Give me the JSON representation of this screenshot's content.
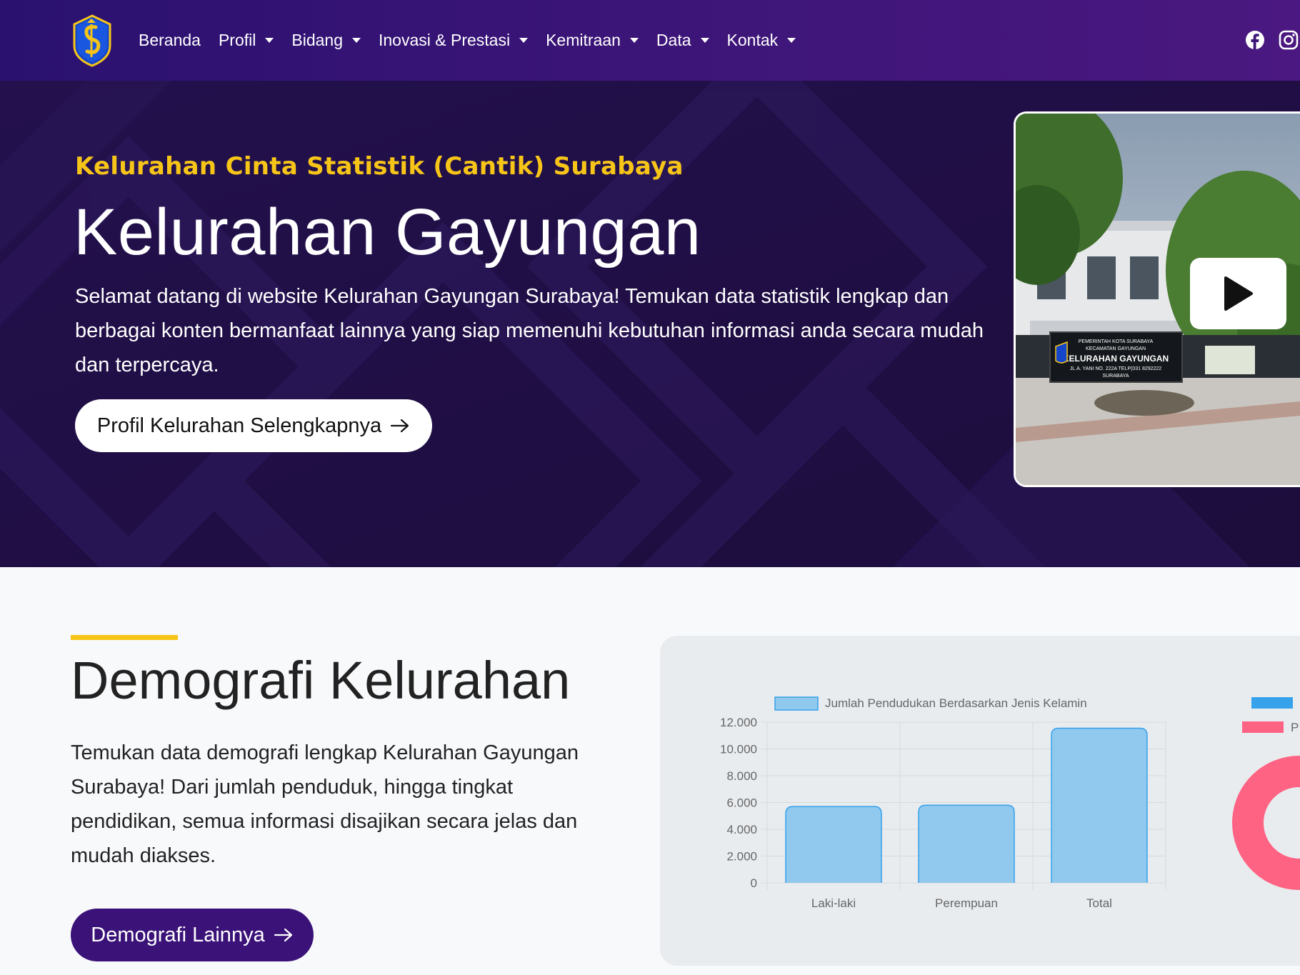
{
  "navbar": {
    "items": [
      {
        "label": "Beranda",
        "dropdown": false
      },
      {
        "label": "Profil",
        "dropdown": true
      },
      {
        "label": "Bidang",
        "dropdown": true
      },
      {
        "label": "Inovasi & Prestasi",
        "dropdown": true
      },
      {
        "label": "Kemitraan",
        "dropdown": true
      },
      {
        "label": "Data",
        "dropdown": true
      },
      {
        "label": "Kontak",
        "dropdown": true
      }
    ],
    "social_icons": [
      "facebook-icon",
      "instagram-icon"
    ]
  },
  "hero": {
    "subtitle": "Kelurahan Cinta Statistik (Cantik) Surabaya",
    "title": "Kelurahan Gayungan",
    "description": "Selamat datang di website Kelurahan Gayungan Surabaya! Temukan data statistik lengkap dan berbagai konten bermanfaat lainnya yang siap memenuhi kebutuhan informasi anda secara mudah dan terpercaya.",
    "button_label": "Profil Kelurahan Selengkapnya",
    "video_sign": {
      "line1": "PEMERINTAH KOTA SURABAYA",
      "line2": "KECAMATAN GAYUNGAN",
      "line3": "KELURAHAN GAYUNGAN",
      "line4": "JL.A. YANI NO. 222A TELP(031 8292222",
      "line5": "SURABAYA"
    }
  },
  "demografi": {
    "title": "Demografi Kelurahan",
    "description": "Temukan data demografi lengkap Kelurahan Gayungan Surabaya! Dari jumlah penduduk, hingga tingkat pendidikan, semua informasi disajikan secara jelas dan mudah diakses.",
    "button_label": "Demografi Lainnya"
  },
  "colors": {
    "nav_bg": "#3c1578",
    "hero_bg": "#1f0f44",
    "accent_yellow": "#f7c518",
    "button_purple": "#3a1278",
    "bar_fill": "#90c8ee",
    "bar_stroke": "#36a2eb",
    "pink": "#ff6384",
    "blue": "#36a2eb"
  },
  "chart_data": [
    {
      "type": "bar",
      "title": "",
      "legend": [
        "Jumlah Pendudukan Berdasarkan Jenis Kelamin"
      ],
      "categories": [
        "Laki-laki",
        "Perempuan",
        "Total"
      ],
      "series": [
        {
          "name": "Jumlah Pendudukan Berdasarkan Jenis Kelamin",
          "values": [
            5700,
            5800,
            11550
          ]
        }
      ],
      "ylim": [
        0,
        12000
      ],
      "yticks": [
        "0",
        "2.000",
        "4.000",
        "6.000",
        "8.000",
        "10.000",
        "12.000"
      ],
      "grid": true,
      "legend_position": "top"
    },
    {
      "type": "pie",
      "note": "doughnut chart, partially cut off at the right edge",
      "legend_colors": [
        "#36a2eb",
        "#ff6384"
      ],
      "legend_partial_label": "P"
    }
  ]
}
